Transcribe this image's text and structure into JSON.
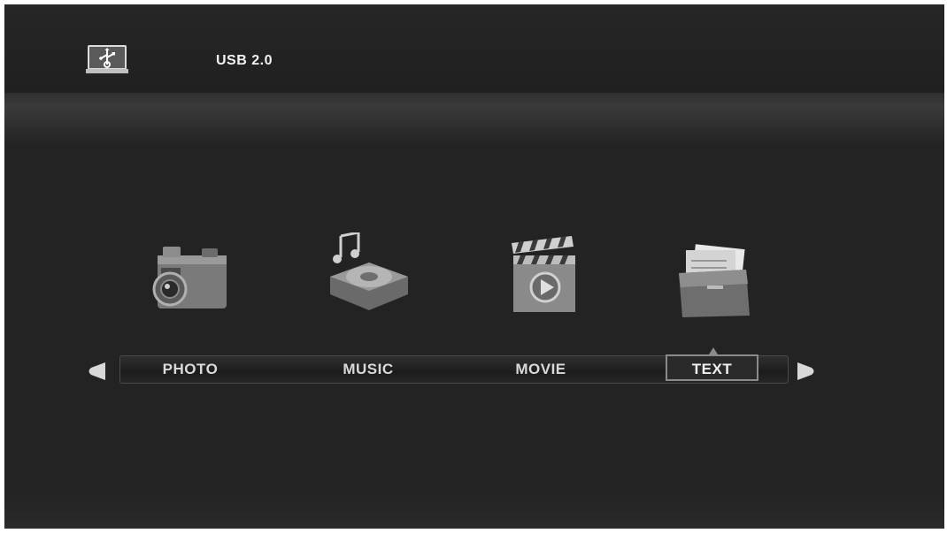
{
  "header": {
    "device_label": "USB 2.0",
    "device_icon": "usb-drive-icon"
  },
  "menu": {
    "items": [
      {
        "label": "PHOTO",
        "icon": "camera-icon"
      },
      {
        "label": "MUSIC",
        "icon": "music-player-icon"
      },
      {
        "label": "MOVIE",
        "icon": "clapperboard-icon"
      },
      {
        "label": "TEXT",
        "icon": "document-folder-icon"
      }
    ],
    "selected": "TEXT",
    "prev_icon": "arrow-left-icon",
    "next_icon": "arrow-right-icon"
  },
  "colors": {
    "background": "#232323",
    "text": "#d9d9d9",
    "selection_border": "#8a8a8a"
  }
}
